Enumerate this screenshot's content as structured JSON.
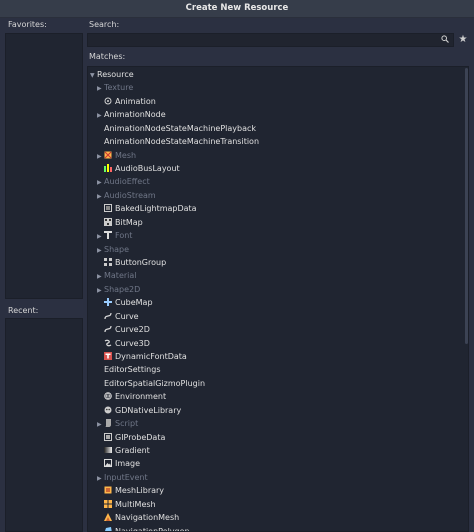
{
  "window": {
    "title": "Create New Resource"
  },
  "sidebar": {
    "favorites_label": "Favorites:",
    "recent_label": "Recent:"
  },
  "search": {
    "label": "Search:",
    "value": "",
    "placeholder": ""
  },
  "matches": {
    "label": "Matches:",
    "items": [
      {
        "label": "Resource",
        "indent": 0,
        "arrow": "down",
        "dim": false,
        "icon": "none"
      },
      {
        "label": "Texture",
        "indent": 1,
        "arrow": "right",
        "dim": true,
        "icon": "none"
      },
      {
        "label": "Animation",
        "indent": 1,
        "arrow": "",
        "dim": false,
        "icon": "animation-icon"
      },
      {
        "label": "AnimationNode",
        "indent": 1,
        "arrow": "right",
        "dim": false,
        "icon": "none"
      },
      {
        "label": "AnimationNodeStateMachinePlayback",
        "indent": 1,
        "arrow": "",
        "dim": false,
        "icon": "none"
      },
      {
        "label": "AnimationNodeStateMachineTransition",
        "indent": 1,
        "arrow": "",
        "dim": false,
        "icon": "none"
      },
      {
        "label": "Mesh",
        "indent": 1,
        "arrow": "right",
        "dim": true,
        "icon": "mesh-icon"
      },
      {
        "label": "AudioBusLayout",
        "indent": 1,
        "arrow": "",
        "dim": false,
        "icon": "audio-bus-icon"
      },
      {
        "label": "AudioEffect",
        "indent": 1,
        "arrow": "right",
        "dim": true,
        "icon": "none"
      },
      {
        "label": "AudioStream",
        "indent": 1,
        "arrow": "right",
        "dim": true,
        "icon": "none"
      },
      {
        "label": "BakedLightmapData",
        "indent": 1,
        "arrow": "",
        "dim": false,
        "icon": "lightmap-icon"
      },
      {
        "label": "BitMap",
        "indent": 1,
        "arrow": "",
        "dim": false,
        "icon": "bitmap-icon"
      },
      {
        "label": "Font",
        "indent": 1,
        "arrow": "right",
        "dim": true,
        "icon": "font-icon"
      },
      {
        "label": "Shape",
        "indent": 1,
        "arrow": "right",
        "dim": true,
        "icon": "none"
      },
      {
        "label": "ButtonGroup",
        "indent": 1,
        "arrow": "",
        "dim": false,
        "icon": "button-group-icon"
      },
      {
        "label": "Material",
        "indent": 1,
        "arrow": "right",
        "dim": true,
        "icon": "none"
      },
      {
        "label": "Shape2D",
        "indent": 1,
        "arrow": "right",
        "dim": true,
        "icon": "none"
      },
      {
        "label": "CubeMap",
        "indent": 1,
        "arrow": "",
        "dim": false,
        "icon": "cubemap-icon"
      },
      {
        "label": "Curve",
        "indent": 1,
        "arrow": "",
        "dim": false,
        "icon": "curve-icon"
      },
      {
        "label": "Curve2D",
        "indent": 1,
        "arrow": "",
        "dim": false,
        "icon": "curve2d-icon"
      },
      {
        "label": "Curve3D",
        "indent": 1,
        "arrow": "",
        "dim": false,
        "icon": "curve3d-icon"
      },
      {
        "label": "DynamicFontData",
        "indent": 1,
        "arrow": "",
        "dim": false,
        "icon": "font-data-icon"
      },
      {
        "label": "EditorSettings",
        "indent": 1,
        "arrow": "",
        "dim": false,
        "icon": "none"
      },
      {
        "label": "EditorSpatialGizmoPlugin",
        "indent": 1,
        "arrow": "",
        "dim": false,
        "icon": "none"
      },
      {
        "label": "Environment",
        "indent": 1,
        "arrow": "",
        "dim": false,
        "icon": "environment-icon"
      },
      {
        "label": "GDNativeLibrary",
        "indent": 1,
        "arrow": "",
        "dim": false,
        "icon": "gdnative-icon"
      },
      {
        "label": "Script",
        "indent": 1,
        "arrow": "right",
        "dim": true,
        "icon": "script-icon"
      },
      {
        "label": "GIProbeData",
        "indent": 1,
        "arrow": "",
        "dim": false,
        "icon": "giprobe-icon"
      },
      {
        "label": "Gradient",
        "indent": 1,
        "arrow": "",
        "dim": false,
        "icon": "gradient-icon"
      },
      {
        "label": "Image",
        "indent": 1,
        "arrow": "",
        "dim": false,
        "icon": "image-icon"
      },
      {
        "label": "InputEvent",
        "indent": 1,
        "arrow": "right",
        "dim": true,
        "icon": "none"
      },
      {
        "label": "MeshLibrary",
        "indent": 1,
        "arrow": "",
        "dim": false,
        "icon": "mesh-library-icon"
      },
      {
        "label": "MultiMesh",
        "indent": 1,
        "arrow": "",
        "dim": false,
        "icon": "multimesh-icon"
      },
      {
        "label": "NavigationMesh",
        "indent": 1,
        "arrow": "",
        "dim": false,
        "icon": "navmesh-icon"
      },
      {
        "label": "NavigationPolygon",
        "indent": 1,
        "arrow": "",
        "dim": false,
        "icon": "navpoly-icon"
      }
    ]
  },
  "icons": {
    "search": "search-icon",
    "favorite": "star-icon"
  }
}
